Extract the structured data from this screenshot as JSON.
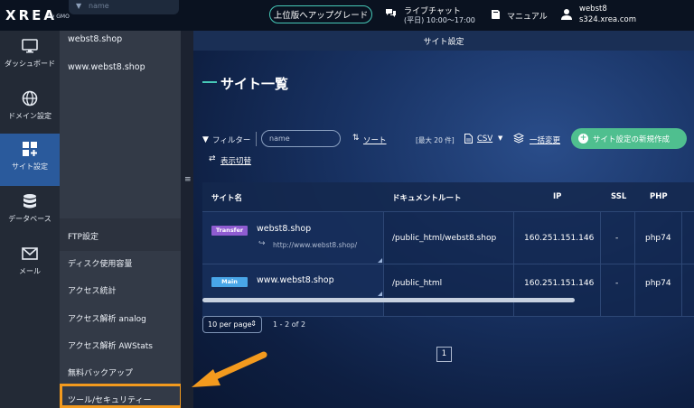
{
  "topbar": {
    "logo": "XREA",
    "logo_sub": "by GMO",
    "search_placeholder": "name",
    "upgrade_label": "上位版へアップグレード",
    "chat_title": "ライブチャット",
    "chat_hours": "(平日) 10:00〜17:00",
    "manual_label": "マニュアル",
    "user_name": "webst8",
    "user_server": "s324.xrea.com"
  },
  "leftnav": [
    {
      "label": "ダッシュボード",
      "icon": "monitor-icon"
    },
    {
      "label": "ドメイン設定",
      "icon": "globe-icon"
    },
    {
      "label": "サイト設定",
      "icon": "grid-plus-icon",
      "active": true
    },
    {
      "label": "データベース",
      "icon": "database-icon"
    },
    {
      "label": "メール",
      "icon": "mail-icon"
    }
  ],
  "subnav": {
    "sites": [
      "webst8.shop",
      "www.webst8.shop"
    ],
    "items": [
      "FTP設定",
      "ディスク使用容量",
      "アクセス統計",
      "アクセス解析 analog",
      "アクセス解析 AWStats",
      "無料バックアップ",
      "ツール/セキュリティー"
    ]
  },
  "main": {
    "header": "サイト設定",
    "title": "サイト一覧",
    "filter_label": "フィルター",
    "filter_placeholder": "name",
    "sort_label": "ソート",
    "max_label": "[最大 20 件]",
    "csv_label": "CSV",
    "bulk_label": "一括変更",
    "new_button": "サイト設定の新規作成",
    "toggle_label": "表示切替",
    "table": {
      "headers": [
        "サイト名",
        "ドキュメントルート",
        "IP",
        "SSL",
        "PHP"
      ],
      "rows": [
        {
          "badge": "Transfer",
          "site": "webst8.shop",
          "url": "http://www.webst8.shop/",
          "docroot": "/public_html/webst8.shop",
          "ip": "160.251.151.146",
          "ssl": "-",
          "php": "php74"
        },
        {
          "badge": "Main",
          "site": "www.webst8.shop",
          "url": "",
          "docroot": "/public_html",
          "ip": "160.251.151.146",
          "ssl": "-",
          "php": "php74"
        }
      ]
    },
    "per_page": "10 per page",
    "range": "1 - 2 of 2",
    "page": "1"
  },
  "colors": {
    "accent": "#47c9b8",
    "active_nav": "#2a5a9c",
    "highlight": "#f39a1e",
    "new_button": "#4fbf8f",
    "badge_transfer": "#8f5cd1",
    "badge_main": "#49a6e8"
  }
}
